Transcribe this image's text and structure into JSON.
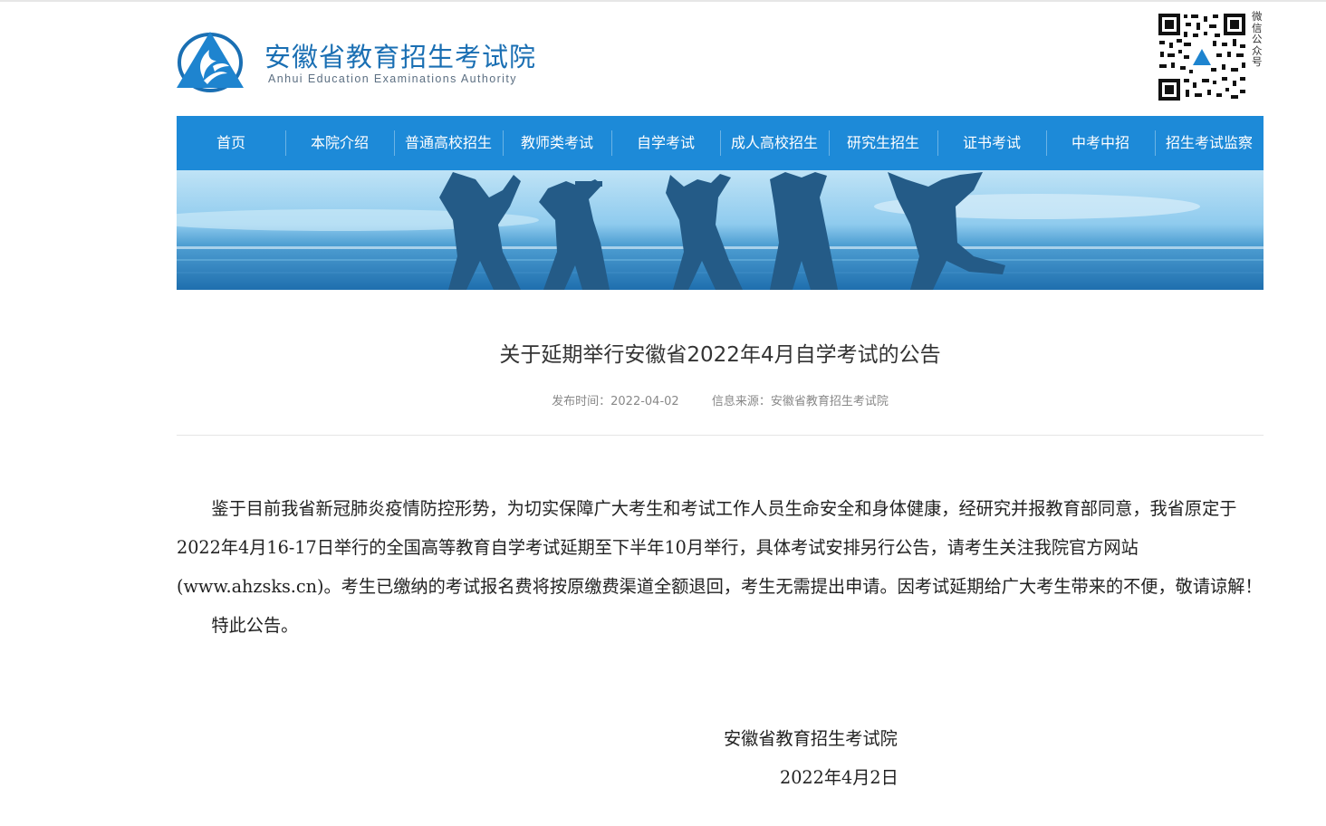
{
  "header": {
    "site_title": "安徽省教育招生考试院",
    "site_subtitle": "Anhui Education Examinations Authority",
    "qr_label": "微信公众号"
  },
  "nav": {
    "items": [
      {
        "label": "首页"
      },
      {
        "label": "本院介绍"
      },
      {
        "label": "普通高校招生"
      },
      {
        "label": "教师类考试"
      },
      {
        "label": "自学考试"
      },
      {
        "label": "成人高校招生"
      },
      {
        "label": "研究生招生"
      },
      {
        "label": "证书考试"
      },
      {
        "label": "中考中招"
      },
      {
        "label": "招生考试监察"
      }
    ]
  },
  "article": {
    "title": "关于延期举行安徽省2022年4月自学考试的公告",
    "publish_time": "发布时间：2022-04-02",
    "source": "信息来源：安徽省教育招生考试院",
    "paragraphs": [
      "鉴于目前我省新冠肺炎疫情防控形势，为切实保障广大考生和考试工作人员生命安全和身体健康，经研究并报教育部同意，我省原定于2022年4月16-17日举行的全国高等教育自学考试延期至下半年10月举行，具体考试安排另行公告，请考生关注我院官方网站(www.ahzsks.cn)。考生已缴纳的考试报名费将按原缴费渠道全额退回，考生无需提出申请。因考试延期给广大考生带来的不便，敬请谅解！",
      "特此公告。"
    ],
    "signature": "安徽省教育招生考试院",
    "date": "2022年4月2日"
  },
  "colors": {
    "nav_background": "#1d8ad8",
    "brand_blue": "#1a6fb3",
    "banner_silhouette": "#245b87"
  }
}
